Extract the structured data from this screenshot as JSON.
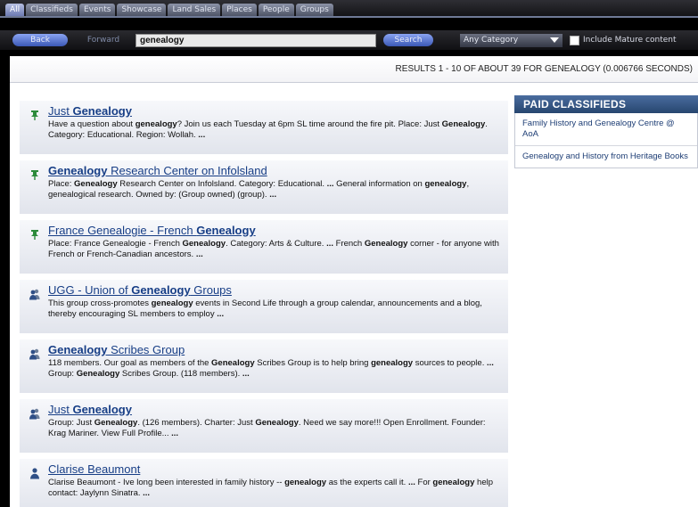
{
  "tabs": [
    "All",
    "Classifieds",
    "Events",
    "Showcase",
    "Land Sales",
    "Places",
    "People",
    "Groups"
  ],
  "toolbar": {
    "back_label": "Back",
    "forward_label": "Forward",
    "search_value": "genealogy",
    "search_label": "Search",
    "category_value": "Any Category",
    "mature_label": "Include Mature content"
  },
  "results_summary": "RESULTS 1 - 10 OF ABOUT 39 FOR GENEALOGY (0.006766 SECONDS)",
  "icons": {
    "place": "pushpin-icon",
    "group": "group-icon",
    "person": "person-icon"
  },
  "results": [
    {
      "icon": "pushpin-icon",
      "title": [
        [
          "",
          "Just "
        ],
        [
          "b",
          "Genealogy"
        ]
      ],
      "snippet": [
        [
          "",
          "Have a question about "
        ],
        [
          "b",
          "genealogy"
        ],
        [
          "",
          "? Join us each Tuesday at 6pm SL time around the fire pit. Place: Just "
        ],
        [
          "b",
          "Genealogy"
        ],
        [
          "",
          ". Category: Educational. Region: Wollah. "
        ],
        [
          "b",
          "..."
        ]
      ]
    },
    {
      "icon": "pushpin-icon",
      "title": [
        [
          "b",
          "Genealogy"
        ],
        [
          "",
          " Research Center on Infolsland"
        ]
      ],
      "snippet": [
        [
          "",
          "Place: "
        ],
        [
          "b",
          "Genealogy"
        ],
        [
          "",
          " Research Center on Infolsland. Category: Educational. "
        ],
        [
          "b",
          "..."
        ],
        [
          "",
          " General information on "
        ],
        [
          "b",
          "genealogy"
        ],
        [
          "",
          ", genealogical research. Owned by: (Group owned) (group). "
        ],
        [
          "b",
          "..."
        ]
      ]
    },
    {
      "icon": "pushpin-icon",
      "title": [
        [
          "",
          "France Genealogie - French "
        ],
        [
          "b",
          "Genealogy"
        ]
      ],
      "snippet": [
        [
          "",
          "Place: France Genealogie - French "
        ],
        [
          "b",
          "Genealogy"
        ],
        [
          "",
          ". Category: Arts & Culture. "
        ],
        [
          "b",
          "..."
        ],
        [
          "",
          " French "
        ],
        [
          "b",
          "Genealogy"
        ],
        [
          "",
          " corner - for anyone with French or French-Canadian ancestors. "
        ],
        [
          "b",
          "..."
        ]
      ]
    },
    {
      "icon": "group-icon",
      "title": [
        [
          "",
          "UGG - Union of "
        ],
        [
          "b",
          "Genealogy"
        ],
        [
          "",
          " Groups"
        ]
      ],
      "snippet": [
        [
          "",
          "This group cross-promotes "
        ],
        [
          "b",
          "genealogy"
        ],
        [
          "",
          " events in Second Life through a group calendar, announcements and a blog, thereby encouraging SL members to employ "
        ],
        [
          "b",
          "..."
        ]
      ]
    },
    {
      "icon": "group-icon",
      "title": [
        [
          "b",
          "Genealogy"
        ],
        [
          "",
          " Scribes Group"
        ]
      ],
      "snippet": [
        [
          "",
          "118 members. Our goal as members of the "
        ],
        [
          "b",
          "Genealogy"
        ],
        [
          "",
          " Scribes Group is to help bring "
        ],
        [
          "b",
          "genealogy"
        ],
        [
          "",
          " sources to people. "
        ],
        [
          "b",
          "..."
        ],
        [
          "",
          " Group: "
        ],
        [
          "b",
          "Genealogy"
        ],
        [
          "",
          " Scribes Group. (118 members). "
        ],
        [
          "b",
          "..."
        ]
      ]
    },
    {
      "icon": "group-icon",
      "title": [
        [
          "",
          "Just "
        ],
        [
          "b",
          "Genealogy"
        ]
      ],
      "snippet": [
        [
          "",
          "Group: Just "
        ],
        [
          "b",
          "Genealogy"
        ],
        [
          "",
          ". (126 members). Charter: Just "
        ],
        [
          "b",
          "Genealogy"
        ],
        [
          "",
          ". Need we say more!!! Open Enrollment. Founder: Krag Mariner. View Full Profile... "
        ],
        [
          "b",
          "..."
        ]
      ]
    },
    {
      "icon": "person-icon",
      "title": [
        [
          "",
          "Clarise Beaumont"
        ]
      ],
      "snippet": [
        [
          "",
          "Clarise Beaumont - Ive long been interested in family history -- "
        ],
        [
          "b",
          "genealogy"
        ],
        [
          "",
          " as the experts call it. "
        ],
        [
          "b",
          "..."
        ],
        [
          "",
          " For "
        ],
        [
          "b",
          "genealogy"
        ],
        [
          "",
          " help contact: Jaylynn Sinatra. "
        ],
        [
          "b",
          "..."
        ]
      ]
    }
  ],
  "paid": {
    "heading": "PAID CLASSIFIEDS",
    "items": [
      "Family History and Genealogy Centre @ AoA",
      "Genealogy and History from Heritage Books"
    ]
  },
  "colors": {
    "link": "#173e86",
    "paid_header": "#27466f",
    "accent_button": "#3b58b6"
  }
}
